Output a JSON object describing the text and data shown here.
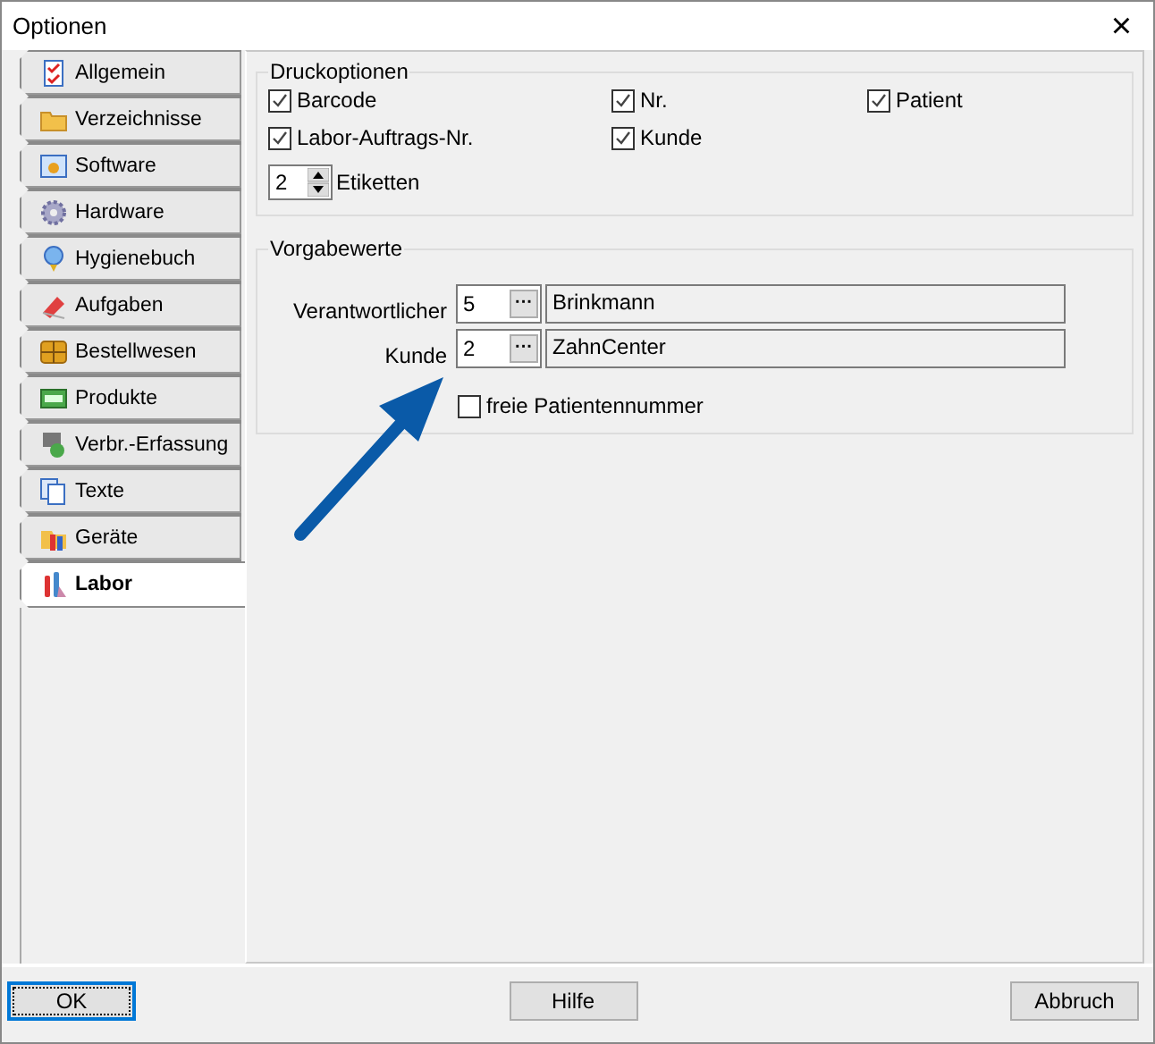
{
  "window": {
    "title": "Optionen",
    "close": "×"
  },
  "tabs": [
    {
      "label": "Allgemein",
      "selected": false
    },
    {
      "label": "Verzeichnisse",
      "selected": false
    },
    {
      "label": "Software",
      "selected": false
    },
    {
      "label": "Hardware",
      "selected": false
    },
    {
      "label": "Hygienebuch",
      "selected": false
    },
    {
      "label": "Aufgaben",
      "selected": false
    },
    {
      "label": "Bestellwesen",
      "selected": false
    },
    {
      "label": "Produkte",
      "selected": false
    },
    {
      "label": "Verbr.-Erfassung",
      "selected": false
    },
    {
      "label": "Texte",
      "selected": false
    },
    {
      "label": "Geräte",
      "selected": false
    },
    {
      "label": "Labor",
      "selected": true
    }
  ],
  "druckoptionen": {
    "title": "Druckoptionen",
    "checkboxes": [
      {
        "label": "Barcode",
        "checked": true
      },
      {
        "label": "Nr.",
        "checked": true
      },
      {
        "label": "Patient",
        "checked": true
      },
      {
        "label": "Labor-Auftrags-Nr.",
        "checked": true
      },
      {
        "label": "Kunde",
        "checked": true
      }
    ],
    "etiketten": {
      "value": "2",
      "label": "Etiketten"
    }
  },
  "vorgabewerte": {
    "title": "Vorgabewerte",
    "rows": [
      {
        "label": "Verantwortlicher",
        "number": "5",
        "browse": "···",
        "name": "Brinkmann"
      },
      {
        "label": "Kunde",
        "number": "2",
        "browse": "···",
        "name": "ZahnCenter"
      }
    ],
    "checkbox": {
      "label": "freie Patientennummer",
      "checked": false
    }
  },
  "buttons": [
    {
      "label": "OK",
      "default": true
    },
    {
      "label": "Hilfe",
      "default": false
    },
    {
      "label": "Abbruch",
      "default": false
    }
  ]
}
